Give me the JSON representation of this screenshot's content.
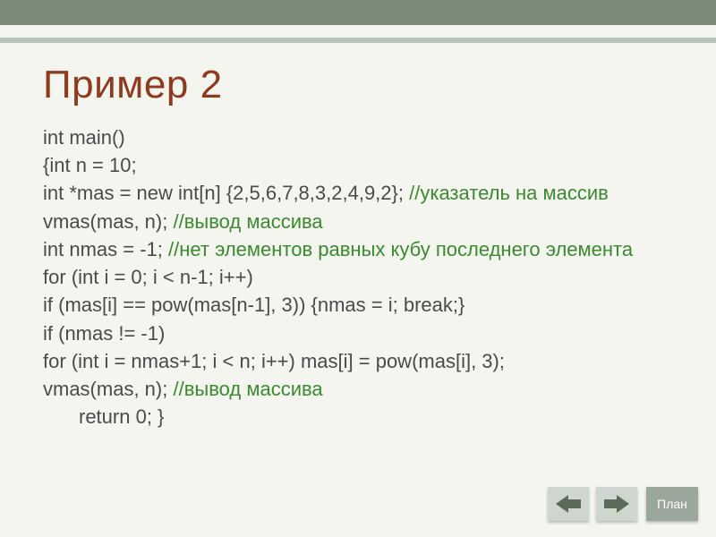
{
  "title": "Пример 2",
  "code": {
    "l1": "int main()",
    "l2": "{int n = 10;",
    "l3a": "int *mas = new int[n] {2,5,6,7,8,3,2,4,9,2}; ",
    "l3b": "//указатель на массив",
    "l4a": "vmas(mas, n); ",
    "l4b": "//вывод массива",
    "l5a": "int nmas = -1; ",
    "l5b": "//нет элементов равных кубу последнего элемента",
    "l6": "for (int i = 0; i < n-1; i++)",
    "l7": "if (mas[i] == pow(mas[n-1], 3)) {nmas = i; break;}",
    "l8": "if (nmas != -1)",
    "l9": "for (int i = nmas+1; i < n; i++) mas[i] = pow(mas[i], 3);",
    "l10a": "vmas(mas, n); ",
    "l10b": "//вывод массива",
    "l11": "return 0; }"
  },
  "buttons": {
    "plan": "План"
  },
  "colors": {
    "title": "#8e3a1f",
    "comment": "#3a8a2f",
    "code": "#4a4a4a",
    "bar_dark": "#7a8b7a",
    "bar_light": "#b9c2b9",
    "bg": "#f5f5f0"
  }
}
